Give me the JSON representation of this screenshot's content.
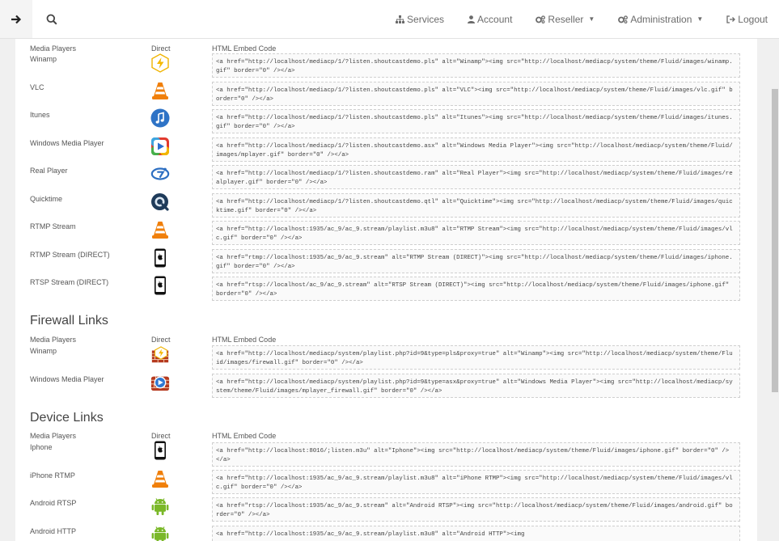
{
  "nav": {
    "services": "Services",
    "account": "Account",
    "reseller": "Reseller",
    "administration": "Administration",
    "logout": "Logout"
  },
  "columns": {
    "direct": "Direct",
    "embed": "HTML Embed Code"
  },
  "media_players": {
    "header_label": "Media Players",
    "rows": [
      {
        "label": "Winamp",
        "icon": "winamp-icon",
        "code": "<a href=\"http://localhost/mediacp/1/?listen.shoutcastdemo.pls\" alt=\"Winamp\"><img src=\"http://localhost/mediacp/system/theme/Fluid/images/winamp.gif\" border=\"0\" /></a>"
      },
      {
        "label": "VLC",
        "icon": "vlc-icon",
        "code": "<a href=\"http://localhost/mediacp/1/?listen.shoutcastdemo.pls\" alt=\"VLC\"><img src=\"http://localhost/mediacp/system/theme/Fluid/images/vlc.gif\" border=\"0\" /></a>"
      },
      {
        "label": "Itunes",
        "icon": "itunes-icon",
        "code": "<a href=\"http://localhost/mediacp/1/?listen.shoutcastdemo.pls\" alt=\"Itunes\"><img src=\"http://localhost/mediacp/system/theme/Fluid/images/itunes.gif\" border=\"0\" /></a>"
      },
      {
        "label": "Windows Media Player",
        "icon": "windows-media-player-icon",
        "code": "<a href=\"http://localhost/mediacp/1/?listen.shoutcastdemo.asx\" alt=\"Windows Media Player\"><img src=\"http://localhost/mediacp/system/theme/Fluid/images/mplayer.gif\" border=\"0\" /></a>"
      },
      {
        "label": "Real Player",
        "icon": "real-player-icon",
        "code": "<a href=\"http://localhost/mediacp/1/?listen.shoutcastdemo.ram\" alt=\"Real Player\"><img src=\"http://localhost/mediacp/system/theme/Fluid/images/realplayer.gif\" border=\"0\" /></a>"
      },
      {
        "label": "Quicktime",
        "icon": "quicktime-icon",
        "code": "<a href=\"http://localhost/mediacp/1/?listen.shoutcastdemo.qtl\" alt=\"Quicktime\"><img src=\"http://localhost/mediacp/system/theme/Fluid/images/quicktime.gif\" border=\"0\" /></a>"
      },
      {
        "label": "RTMP Stream",
        "icon": "vlc-icon",
        "code": "<a href=\"http://localhost:1935/ac_9/ac_9.stream/playlist.m3u8\" alt=\"RTMP Stream\"><img src=\"http://localhost/mediacp/system/theme/Fluid/images/vlc.gif\" border=\"0\" /></a>"
      },
      {
        "label": "RTMP Stream (DIRECT)",
        "icon": "iphone-icon",
        "code": "<a href=\"rtmp://localhost:1935/ac_9/ac_9.stream\" alt=\"RTMP Stream (DIRECT)\"><img src=\"http://localhost/mediacp/system/theme/Fluid/images/iphone.gif\" border=\"0\" /></a>"
      },
      {
        "label": "RTSP Stream (DIRECT)",
        "icon": "iphone-icon",
        "code": "<a href=\"rtsp://localhost/ac_9/ac_9.stream\" alt=\"RTSP Stream (DIRECT)\"><img src=\"http://localhost/mediacp/system/theme/Fluid/images/iphone.gif\" border=\"0\" /></a>"
      }
    ]
  },
  "firewall_links": {
    "title": "Firewall Links",
    "header_label": "Media Players",
    "rows": [
      {
        "label": "Winamp",
        "icon": "winamp-firewall-icon",
        "code": "<a href=\"http://localhost/mediacp/system/playlist.php?id=9&type=pls&proxy=true\" alt=\"Winamp\"><img src=\"http://localhost/mediacp/system/theme/Fluid/images/firewall.gif\" border=\"0\" /></a>"
      },
      {
        "label": "Windows Media Player",
        "icon": "mplayer-firewall-icon",
        "code": "<a href=\"http://localhost/mediacp/system/playlist.php?id=9&type=asx&proxy=true\" alt=\"Windows Media Player\"><img src=\"http://localhost/mediacp/system/theme/Fluid/images/mplayer_firewall.gif\" border=\"0\" /></a>"
      }
    ]
  },
  "device_links": {
    "title": "Device Links",
    "header_label": "Media Players",
    "rows": [
      {
        "label": "Iphone",
        "icon": "iphone-icon",
        "code": "<a href=\"http://localhost:8016/;listen.m3u\" alt=\"Iphone\"><img src=\"http://localhost/mediacp/system/theme/Fluid/images/iphone.gif\" border=\"0\" /></a>"
      },
      {
        "label": "iPhone RTMP",
        "icon": "vlc-icon",
        "code": "<a href=\"http://localhost:1935/ac_9/ac_9.stream/playlist.m3u8\" alt=\"iPhone RTMP\"><img src=\"http://localhost/mediacp/system/theme/Fluid/images/vlc.gif\" border=\"0\" /></a>"
      },
      {
        "label": "Android RTSP",
        "icon": "android-icon",
        "code": "<a href=\"rtsp://localhost:1935/ac_9/ac_9.stream\" alt=\"Android RTSP\"><img src=\"http://localhost/mediacp/system/theme/Fluid/images/android.gif\" border=\"0\" /></a>"
      },
      {
        "label": "Android HTTP",
        "icon": "android-icon",
        "code": "<a href=\"http://localhost:1935/ac_9/ac_9.stream/playlist.m3u8\" alt=\"Android HTTP\"><img"
      }
    ]
  }
}
